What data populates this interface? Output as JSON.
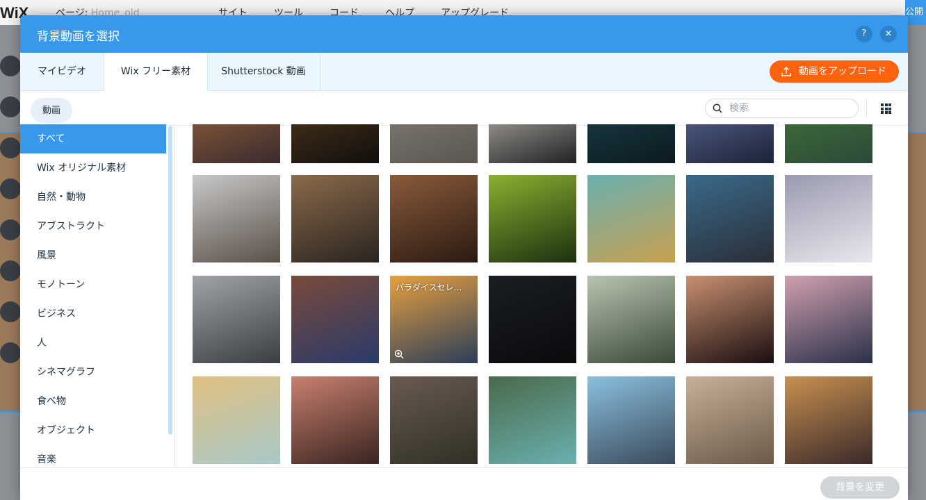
{
  "editor": {
    "logo": "WiX",
    "page_prefix": "ページ:",
    "page_name": "Home_old",
    "menu": [
      "サイト",
      "ツール",
      "コード",
      "ヘルプ",
      "アップグレード"
    ],
    "publish": "公開"
  },
  "modal": {
    "title": "背景動画を選択",
    "help": "?",
    "close": "×",
    "tabs": [
      {
        "label": "マイビデオ",
        "active": false
      },
      {
        "label": "Wix フリー素材",
        "active": true
      },
      {
        "label": "Shutterstock 動画",
        "active": false
      }
    ],
    "upload_label": "動画をアップロード",
    "filter_chip": "動画",
    "search_placeholder": "検索",
    "categories": [
      {
        "label": "すべて",
        "active": true
      },
      {
        "label": "Wix オリジナル素材"
      },
      {
        "label": "自然・動物"
      },
      {
        "label": "アブストラクト"
      },
      {
        "label": "風景"
      },
      {
        "label": "モノトーン"
      },
      {
        "label": "ビジネス"
      },
      {
        "label": "人"
      },
      {
        "label": "シネマグラフ"
      },
      {
        "label": "食べ物"
      },
      {
        "label": "オブジェクト"
      },
      {
        "label": "音楽"
      }
    ],
    "hover_label": "パラダイスセレ...",
    "apply_label": "背景を変更",
    "thumbs": [
      {
        "name": "field-sunset",
        "c1": "#a46e3c",
        "c2": "#3a2a2e"
      },
      {
        "name": "lake-dusk",
        "c1": "#5a4020",
        "c2": "#120e0c"
      },
      {
        "name": "misty-beach",
        "c1": "#8c8680",
        "c2": "#5a554f"
      },
      {
        "name": "coffee-cup",
        "c1": "#d7d2cc",
        "c2": "#222"
      },
      {
        "name": "night-valley",
        "c1": "#1f4650",
        "c2": "#0b1a20"
      },
      {
        "name": "blue-flowers",
        "c1": "#6a78a8",
        "c2": "#1b2238"
      },
      {
        "name": "aerial-green",
        "c1": "#4a7a3a",
        "c2": "#2a4a38"
      },
      {
        "name": "snowy-forest",
        "c1": "#c8c8c8",
        "c2": "#5a5048"
      },
      {
        "name": "bread-cutting",
        "c1": "#8a6a4a",
        "c2": "#2a2420"
      },
      {
        "name": "chocolate-truffles",
        "c1": "#8a5a3a",
        "c2": "#2a1a12"
      },
      {
        "name": "green-leaves",
        "c1": "#8ab030",
        "c2": "#1c3010"
      },
      {
        "name": "wheat-grass",
        "c1": "#6ab0b0",
        "c2": "#c8a050"
      },
      {
        "name": "construction-crane",
        "c1": "#3a6a8a",
        "c2": "#2a2e38"
      },
      {
        "name": "snowy-mountain",
        "c1": "#9a9ab0",
        "c2": "#e8e8ee"
      },
      {
        "name": "film-reel",
        "c1": "#a0a4a8",
        "c2": "#3a3e42"
      },
      {
        "name": "friends-circle",
        "c1": "#7a4a3a",
        "c2": "#2a3a6a"
      },
      {
        "name": "paradise-sunset",
        "c1": "#e8a040",
        "c2": "#2a3e58"
      },
      {
        "name": "speedometer",
        "c1": "#1a1e22",
        "c2": "#0a0a0c"
      },
      {
        "name": "runner-field",
        "c1": "#b8c4b0",
        "c2": "#3a4a38"
      },
      {
        "name": "mountain-sunset",
        "c1": "#c89070",
        "c2": "#1a0e10"
      },
      {
        "name": "beach-runner",
        "c1": "#d0a0b0",
        "c2": "#2a3048"
      },
      {
        "name": "seashells",
        "c1": "#e0c080",
        "c2": "#a8c8c8"
      },
      {
        "name": "couple-laughing",
        "c1": "#c88070",
        "c2": "#3a2420"
      },
      {
        "name": "salad-bowl",
        "c1": "#6a5a50",
        "c2": "#303024"
      },
      {
        "name": "tropical-beach",
        "c1": "#4a6a4a",
        "c2": "#6ab0b0"
      },
      {
        "name": "city-skyline",
        "c1": "#8ac0e0",
        "c2": "#3a4a5a"
      },
      {
        "name": "pottery-wheel",
        "c1": "#c8b098",
        "c2": "#6a5a48"
      },
      {
        "name": "breakfast-table",
        "c1": "#c89050",
        "c2": "#3a2a2a"
      }
    ]
  }
}
